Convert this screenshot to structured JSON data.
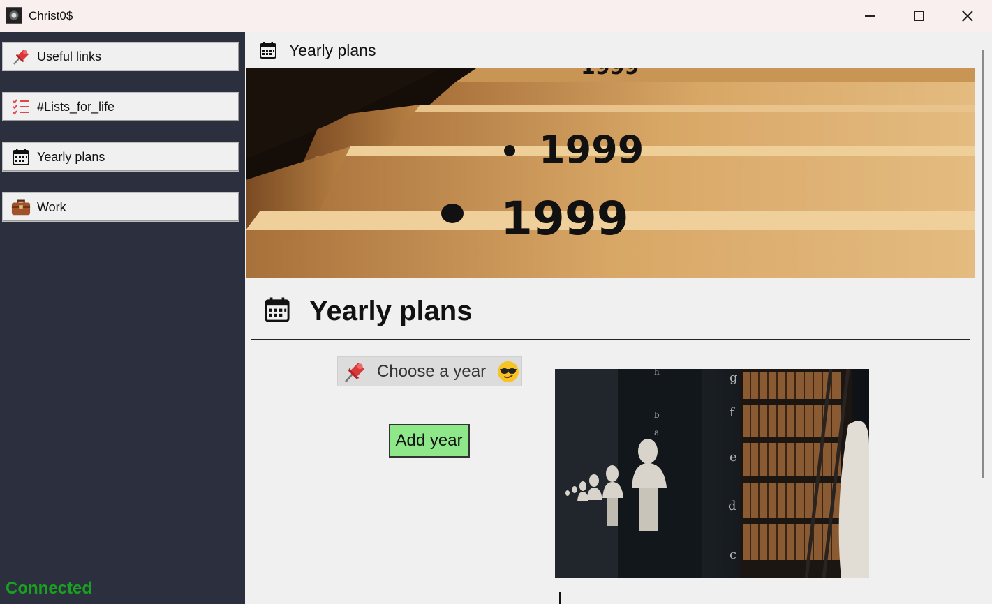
{
  "window": {
    "title": "Christ0$"
  },
  "sidebar": {
    "items": [
      {
        "label": "Useful links",
        "icon": "pushpin-icon"
      },
      {
        "label": "#Lists_for_life",
        "icon": "list-icon"
      },
      {
        "label": "Yearly plans",
        "icon": "calendar-icon"
      },
      {
        "label": "Work",
        "icon": "briefcase-icon"
      }
    ],
    "status": "Connected",
    "status_color": "#1aa020"
  },
  "main": {
    "header_title": "Yearly plans",
    "banner_numbers": [
      "1999",
      "1999",
      "1999"
    ],
    "section_title": "Yearly plans",
    "year_picker_label": "Choose a year",
    "add_year_label": "Add year",
    "library_shelf_letters": [
      "g",
      "f",
      "e",
      "d",
      "c",
      "h",
      "b",
      "a"
    ]
  },
  "colors": {
    "sidebar_bg": "#2c303e",
    "main_bg": "#f0f0f0",
    "add_button_bg": "#8ee88a",
    "pin_red": "#d9393b",
    "briefcase_brown": "#a0522d"
  }
}
